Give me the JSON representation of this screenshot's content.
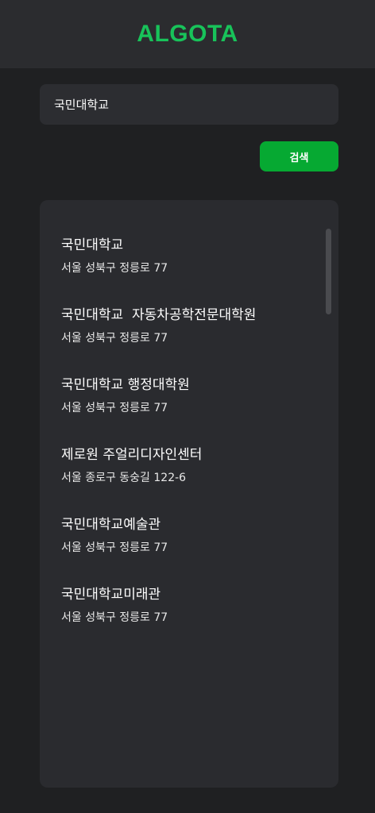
{
  "header": {
    "logo": "ALGOTA"
  },
  "search": {
    "value": "국민대학교",
    "button_label": "검색"
  },
  "results": [
    {
      "name": "국민대학교",
      "address": "서울 성북구 정릉로 77"
    },
    {
      "name": "국민대학교  자동차공학전문대학원",
      "address": "서울 성북구 정릉로 77"
    },
    {
      "name": "국민대학교 행정대학원",
      "address": "서울 성북구 정릉로 77"
    },
    {
      "name": "제로원 주얼리디자인센터",
      "address": "서울 종로구 동숭길 122-6"
    },
    {
      "name": "국민대학교예술관",
      "address": "서울 성북구 정릉로 77"
    },
    {
      "name": "국민대학교미래관",
      "address": "서울 성북구 정릉로 77"
    }
  ],
  "colors": {
    "accent": "#18c35a",
    "button": "#06a932",
    "background": "#1f2022",
    "panel": "#2a2b2f"
  }
}
